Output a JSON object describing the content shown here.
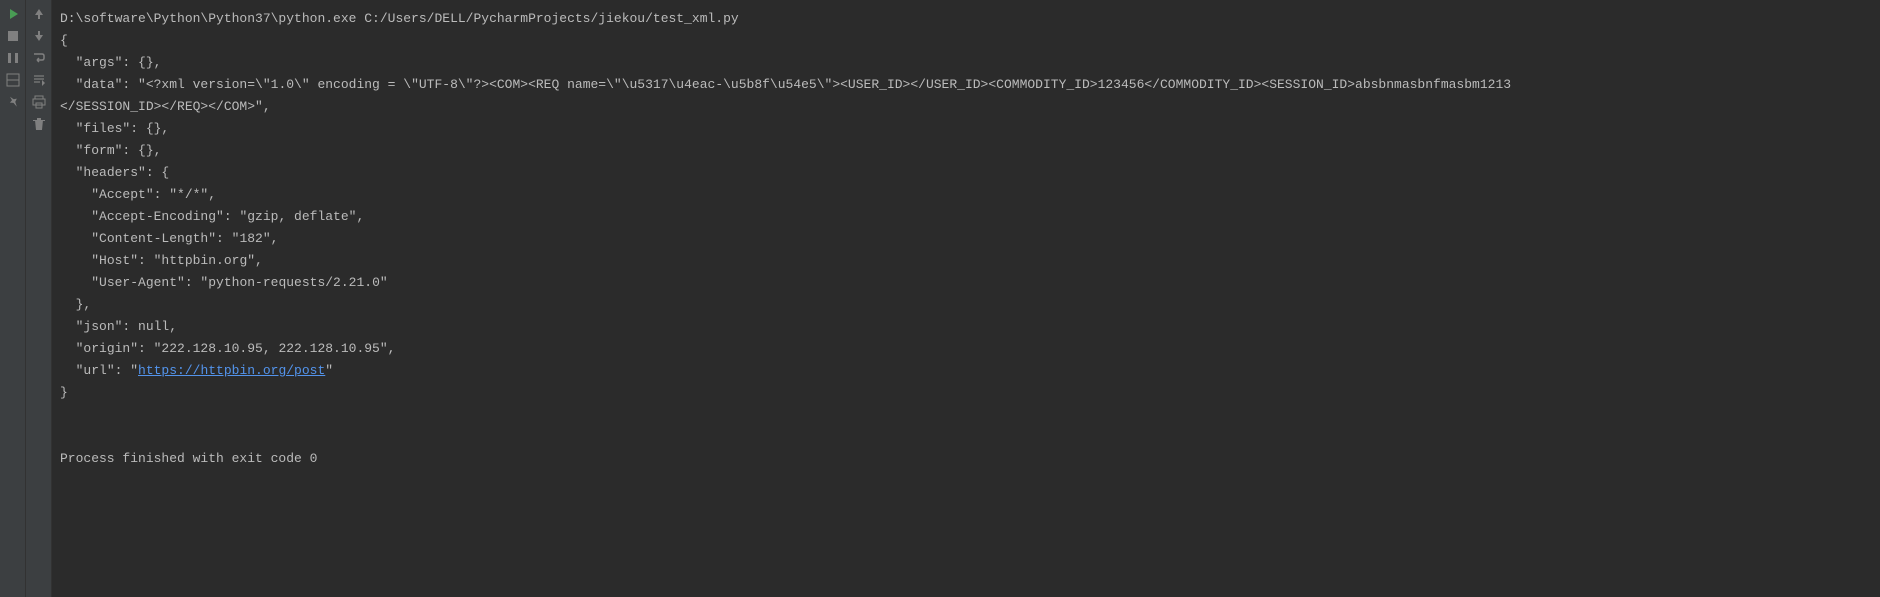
{
  "console": {
    "command": "D:\\software\\Python\\Python37\\python.exe C:/Users/DELL/PycharmProjects/jiekou/test_xml.py",
    "line_open": "{",
    "line_args": "  \"args\": {},",
    "line_data_1": "  \"data\": \"<?xml version=\\\"1.0\\\" encoding = \\\"UTF-8\\\"?><COM><REQ name=\\\"\\u5317\\u4eac-\\u5b8f\\u54e5\\\"><USER_ID></USER_ID><COMMODITY_ID>123456</COMMODITY_ID><SESSION_ID>absbnmasbnfmasbm1213",
    "line_data_2": "</SESSION_ID></REQ></COM>\",",
    "line_files": "  \"files\": {},",
    "line_form": "  \"form\": {},",
    "line_headers": "  \"headers\": {",
    "line_accept": "    \"Accept\": \"*/*\",",
    "line_encoding": "    \"Accept-Encoding\": \"gzip, deflate\",",
    "line_contentlength": "    \"Content-Length\": \"182\",",
    "line_host": "    \"Host\": \"httpbin.org\",",
    "line_useragent": "    \"User-Agent\": \"python-requests/2.21.0\"",
    "line_headers_close": "  },",
    "line_json": "  \"json\": null,",
    "line_origin": "  \"origin\": \"222.128.10.95, 222.128.10.95\",",
    "line_url_prefix": "  \"url\": \"",
    "line_url_link": "https://httpbin.org/post",
    "line_url_suffix": "\"",
    "line_close": "}",
    "exit_message": "Process finished with exit code 0"
  }
}
